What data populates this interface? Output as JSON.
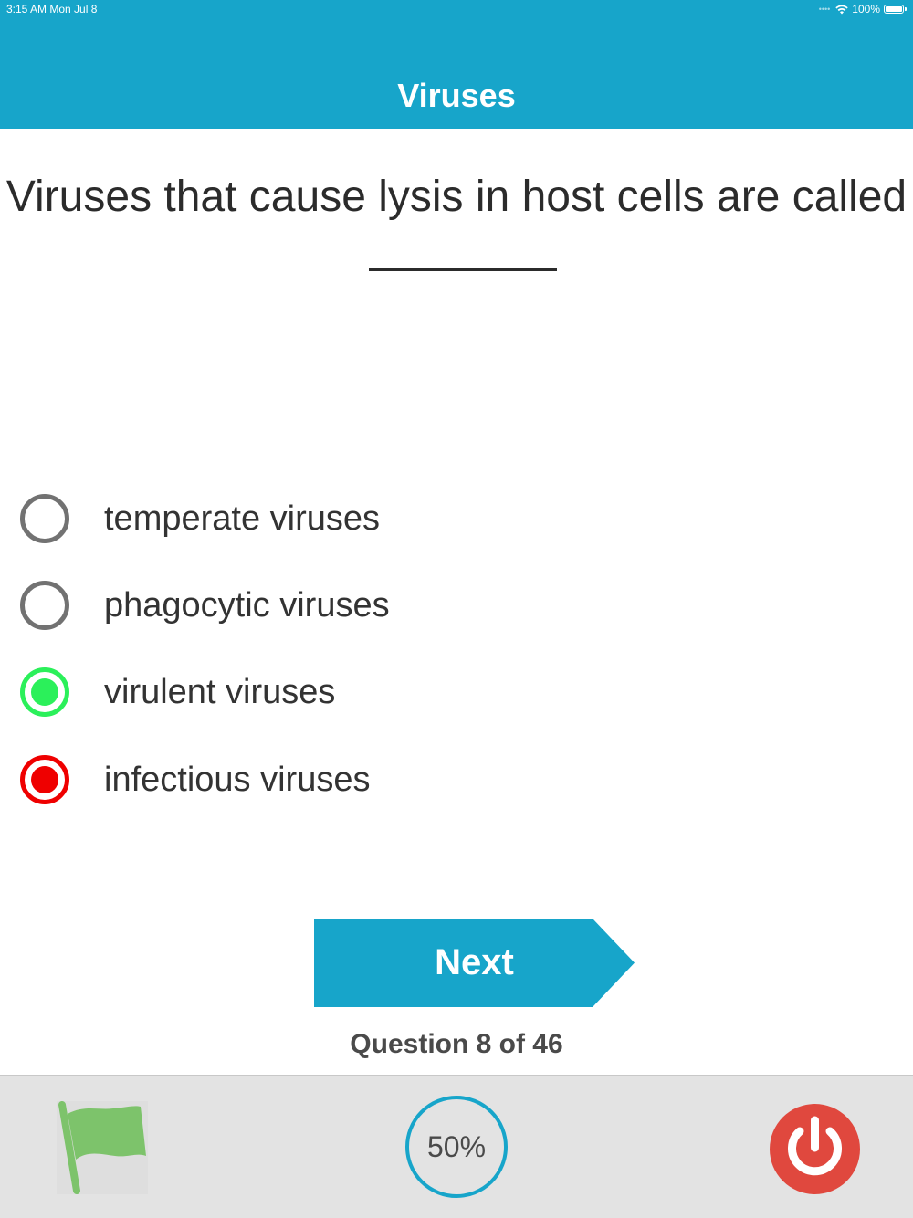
{
  "status_bar": {
    "time": "3:15 AM   Mon Jul 8",
    "battery": "100%"
  },
  "header": {
    "title": "Viruses",
    "color": "#17a5ca"
  },
  "question": {
    "text": "Viruses that cause lysis in host cells are called"
  },
  "options": [
    {
      "label": "temperate viruses",
      "state": "unselected"
    },
    {
      "label": "phagocytic viruses",
      "state": "unselected"
    },
    {
      "label": "virulent viruses",
      "state": "correct"
    },
    {
      "label": "infectious viruses",
      "state": "incorrect"
    }
  ],
  "next_button": {
    "label": "Next"
  },
  "progress": {
    "text": "Question 8 of 46"
  },
  "bottom_bar": {
    "flag_icon": "flag-icon",
    "score_percent": "50%",
    "power_icon": "power-icon"
  },
  "colors": {
    "accent": "#17a5ca",
    "correct": "#2bf05a",
    "incorrect": "#ef0000",
    "flag": "#7dc36b",
    "power": "#e0483e"
  }
}
